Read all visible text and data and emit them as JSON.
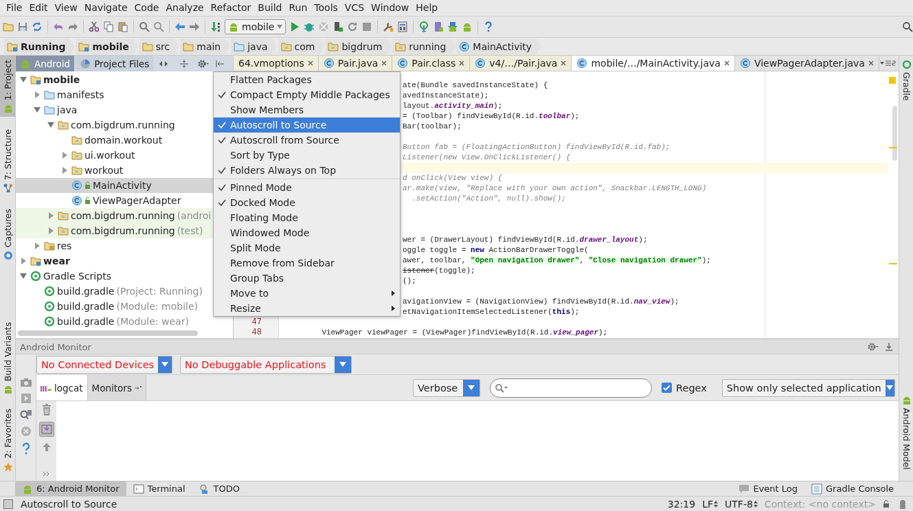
{
  "menu_bar": [
    "File",
    "Edit",
    "View",
    "Navigate",
    "Code",
    "Analyze",
    "Refactor",
    "Build",
    "Run",
    "Tools",
    "VCS",
    "Window",
    "Help"
  ],
  "toolbar": {
    "run_config": "mobile"
  },
  "breadcrumbs": [
    {
      "label": "Running",
      "kind": "module"
    },
    {
      "label": "mobile",
      "kind": "module"
    },
    {
      "label": "src",
      "kind": "folder"
    },
    {
      "label": "main",
      "kind": "folder"
    },
    {
      "label": "java",
      "kind": "source"
    },
    {
      "label": "com",
      "kind": "package"
    },
    {
      "label": "bigdrum",
      "kind": "package"
    },
    {
      "label": "running",
      "kind": "package"
    },
    {
      "label": "MainActivity",
      "kind": "class"
    }
  ],
  "left_stripe": [
    {
      "label": "1: Project",
      "selected": true,
      "kind": "top"
    },
    {
      "label": "7: Structure",
      "selected": false,
      "kind": "top"
    },
    {
      "label": "Captures",
      "selected": false,
      "kind": "top"
    },
    {
      "label": "Build Variants",
      "selected": false,
      "kind": "bottom"
    },
    {
      "label": "2: Favorites",
      "selected": false,
      "kind": "bottom"
    }
  ],
  "project_panel": {
    "tabs": [
      {
        "label": "Android",
        "selected": true
      },
      {
        "label": "Project Files",
        "selected": false
      }
    ],
    "tree": [
      {
        "label": "mobile",
        "kind": "module",
        "expanded": true,
        "selected": false,
        "children": [
          {
            "label": "manifests",
            "kind": "folder",
            "expanded": false,
            "selected": false
          },
          {
            "label": "java",
            "kind": "folder",
            "expanded": true,
            "selected": false,
            "children": [
              {
                "label": "com.bigdrum.running",
                "kind": "package",
                "expanded": true,
                "selected": false,
                "children": [
                  {
                    "label": "domain.workout",
                    "kind": "package",
                    "selected": false
                  },
                  {
                    "label": "ui.workout",
                    "kind": "package",
                    "expanded": false,
                    "selected": false
                  },
                  {
                    "label": "workout",
                    "kind": "package",
                    "expanded": false,
                    "selected": false
                  },
                  {
                    "label": "MainActivity",
                    "kind": "class",
                    "selected": true
                  },
                  {
                    "label": "ViewPagerAdapter",
                    "kind": "class",
                    "selected": false
                  }
                ]
              },
              {
                "label": "com.bigdrum.running",
                "suffix": "(androi",
                "kind": "test-package",
                "expanded": false,
                "selected": false
              },
              {
                "label": "com.bigdrum.running",
                "suffix": "(test)",
                "kind": "test-package",
                "expanded": false,
                "selected": false
              }
            ]
          },
          {
            "label": "res",
            "kind": "res",
            "expanded": false,
            "selected": false
          }
        ]
      },
      {
        "label": "wear",
        "kind": "module",
        "expanded": false,
        "selected": false
      },
      {
        "label": "Gradle Scripts",
        "kind": "gradle-root",
        "expanded": true,
        "selected": false,
        "children": [
          {
            "label": "build.gradle",
            "suffix": "(Project: Running)",
            "kind": "gradle",
            "selected": false
          },
          {
            "label": "build.gradle",
            "suffix": "(Module: mobile)",
            "kind": "gradle",
            "selected": false
          },
          {
            "label": "build.gradle",
            "suffix": "(Module: wear)",
            "kind": "gradle",
            "selected": false
          }
        ]
      }
    ]
  },
  "editor": {
    "tabs": [
      {
        "label": "64.vmoptions",
        "kind": "library",
        "selected": false
      },
      {
        "label": "Pair.java",
        "kind": "library",
        "selected": false
      },
      {
        "label": "Pair.class",
        "kind": "library",
        "selected": false
      },
      {
        "label": "v4/…/Pair.java",
        "kind": "library",
        "selected": false
      },
      {
        "label": "mobile/…/MainActivity.java",
        "kind": "project",
        "selected": true
      },
      {
        "label": "ViewPagerAdapter.java",
        "kind": "project",
        "selected": false
      }
    ],
    "lines": [
      {
        "current": false,
        "segments": [
          {
            "text": "ate(Bundle savedInstanceState) {",
            "kind": "plain"
          }
        ]
      },
      {
        "current": false,
        "segments": [
          {
            "text": "avedInstanceState);",
            "kind": "plain"
          }
        ]
      },
      {
        "current": false,
        "segments": [
          {
            "text": "layout.",
            "kind": "plain"
          },
          {
            "text": "activity_main",
            "kind": "field"
          },
          {
            "text": ");",
            "kind": "plain"
          }
        ]
      },
      {
        "current": false,
        "segments": [
          {
            "text": "= (Toolbar) findViewById(R.id.",
            "kind": "plain"
          },
          {
            "text": "toolbar",
            "kind": "field"
          },
          {
            "text": ");",
            "kind": "plain"
          }
        ]
      },
      {
        "current": false,
        "segments": [
          {
            "text": "Bar(toolbar);",
            "kind": "plain"
          }
        ]
      },
      {
        "current": false
      },
      {
        "current": false,
        "segments": [
          {
            "text": "Button fab = (FloatingActionButton) findViewById(R.id.fab);",
            "kind": "comment"
          }
        ]
      },
      {
        "current": false,
        "segments": [
          {
            "text": "Listener(new View.OnClickListener() {",
            "kind": "comment"
          }
        ]
      },
      {
        "current": true
      },
      {
        "current": false,
        "segments": [
          {
            "text": "d onClick(View view) {",
            "kind": "comment"
          }
        ]
      },
      {
        "current": false,
        "segments": [
          {
            "text": "ar.make(view, \"Replace with your own action\", Snackbar.LENGTH_LONG)",
            "kind": "comment"
          }
        ]
      },
      {
        "current": false,
        "segments": [
          {
            "text": "  .setAction(\"Action\", null).show();",
            "kind": "comment"
          }
        ]
      },
      {
        "current": false
      },
      {
        "current": false
      },
      {
        "current": false
      },
      {
        "current": false,
        "segments": [
          {
            "text": "wer = (DrawerLayout) findViewById(R.id.",
            "kind": "plain"
          },
          {
            "text": "drawer_layout",
            "kind": "field"
          },
          {
            "text": ");",
            "kind": "plain"
          }
        ]
      },
      {
        "current": false,
        "segments": [
          {
            "text": "oggle toggle = ",
            "kind": "plain"
          },
          {
            "text": "new",
            "kind": "keyword"
          },
          {
            "text": " ActionBarDrawerToggle(",
            "kind": "plain"
          }
        ]
      },
      {
        "current": false,
        "segments": [
          {
            "text": "awer, toolbar, ",
            "kind": "plain"
          },
          {
            "text": "\"Open navigation drawer\"",
            "kind": "string"
          },
          {
            "text": ", ",
            "kind": "plain"
          },
          {
            "text": "\"Close navigation drawer\"",
            "kind": "string"
          },
          {
            "text": ");",
            "kind": "plain"
          }
        ]
      },
      {
        "current": false,
        "segments": [
          {
            "text": "istener",
            "kind": "deprecated"
          },
          {
            "text": "(toggle);",
            "kind": "plain"
          }
        ]
      },
      {
        "current": false,
        "segments": [
          {
            "text": "();",
            "kind": "plain"
          }
        ]
      },
      {
        "current": false
      },
      {
        "current": false,
        "segments": [
          {
            "text": "avigationView = (NavigationView) findViewById(R.id.",
            "kind": "plain"
          },
          {
            "text": "nav_view",
            "kind": "field"
          },
          {
            "text": ");",
            "kind": "plain"
          }
        ]
      },
      {
        "current": false,
        "segments": [
          {
            "text": "etNavigationItemSelectedListener(",
            "kind": "plain"
          },
          {
            "text": "this",
            "kind": "keyword"
          },
          {
            "text": ");",
            "kind": "plain"
          }
        ]
      },
      {
        "number": "47",
        "current": false
      },
      {
        "number": "48",
        "current": false,
        "segments": [
          {
            "text": "    ViewPager viewPager = (ViewPager)findViewById(R.id.",
            "kind": "plain"
          },
          {
            "text": "view_pager",
            "kind": "field"
          },
          {
            "text": ");",
            "kind": "plain"
          }
        ]
      }
    ]
  },
  "view_menu": {
    "groups": [
      [
        {
          "label": "Flatten Packages",
          "kind": "item",
          "checked": false,
          "selected": false
        },
        {
          "label": "Compact Empty Middle Packages",
          "kind": "item",
          "checked": true,
          "selected": false
        },
        {
          "label": "Show Members",
          "kind": "item",
          "checked": false,
          "selected": false
        },
        {
          "label": "Autoscroll to Source",
          "kind": "item",
          "checked": true,
          "selected": true
        },
        {
          "label": "Autoscroll from Source",
          "kind": "item",
          "checked": true,
          "selected": false
        },
        {
          "label": "Sort by Type",
          "kind": "item",
          "checked": false,
          "selected": false
        },
        {
          "label": "Folders Always on Top",
          "kind": "item",
          "checked": true,
          "selected": false
        }
      ],
      [
        {
          "label": "Pinned Mode",
          "kind": "item",
          "checked": true,
          "selected": false
        },
        {
          "label": "Docked Mode",
          "kind": "item",
          "checked": true,
          "selected": false
        },
        {
          "label": "Floating Mode",
          "kind": "item",
          "checked": false,
          "selected": false
        },
        {
          "label": "Windowed Mode",
          "kind": "item",
          "checked": false,
          "selected": false
        },
        {
          "label": "Split Mode",
          "kind": "item",
          "checked": false,
          "selected": false
        },
        {
          "label": "Remove from Sidebar",
          "kind": "item",
          "checked": false,
          "selected": false
        },
        {
          "label": "Group Tabs",
          "kind": "item",
          "checked": false,
          "selected": false
        },
        {
          "label": "Move to",
          "kind": "submenu",
          "checked": false,
          "selected": false
        },
        {
          "label": "Resize",
          "kind": "submenu",
          "checked": false,
          "selected": false
        }
      ]
    ]
  },
  "right_stripe": [
    {
      "label": "Gradle",
      "kind": "top"
    },
    {
      "label": "Android Model",
      "kind": "bottom"
    }
  ],
  "android_monitor": {
    "title": "Android Monitor",
    "device": "No Connected Devices",
    "application": "No Debuggable Applications",
    "tabs": [
      {
        "label": "logcat",
        "selected": true
      },
      {
        "label": "Monitors",
        "selected": false
      }
    ],
    "log_level": "Verbose",
    "regex": {
      "label": "Regex",
      "checked": true
    },
    "filter": "Show only selected application"
  },
  "bottom_bar": {
    "tools": [
      {
        "label": "6: Android Monitor",
        "selected": true,
        "kind": "android"
      },
      {
        "label": "Terminal",
        "selected": false,
        "kind": "terminal"
      },
      {
        "label": "TODO",
        "selected": false,
        "kind": "todo"
      }
    ],
    "right": [
      {
        "label": "Event Log",
        "kind": "event"
      },
      {
        "label": "Gradle Console",
        "kind": "console"
      }
    ]
  },
  "status_bar": {
    "message": "Autoscroll to Source",
    "position": "32:19",
    "line_separator": "LF",
    "encoding": "UTF-8",
    "context": "Context: <no context>"
  }
}
